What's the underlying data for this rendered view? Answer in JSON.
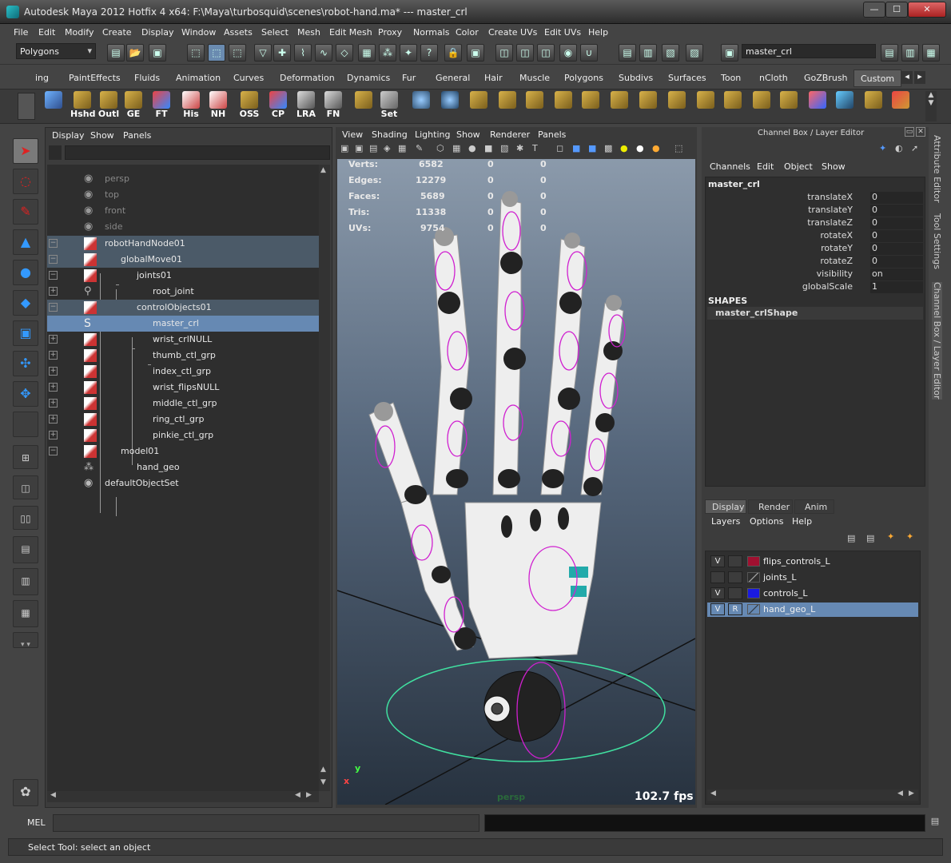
{
  "title": {
    "text": "Autodesk Maya 2012 Hotfix 4 x64: F:\\Maya\\turbosquid\\scenes\\robot-hand.ma*   ---   master_crl"
  },
  "menubar": [
    "File",
    "Edit",
    "Modify",
    "Create",
    "Display",
    "Window",
    "Assets",
    "Select",
    "Mesh",
    "Edit Mesh",
    "Proxy",
    "Normals",
    "Color",
    "Create UVs",
    "Edit UVs",
    "Help"
  ],
  "statusline": {
    "mode": "Polygons",
    "field_value": "master_crl"
  },
  "shelf_tabs": [
    "ing",
    "PaintEffects",
    "Fluids",
    "Animation",
    "Curves",
    "Deformation",
    "Dynamics",
    "Fur",
    "General",
    "Hair",
    "Muscle",
    "Polygons",
    "Subdivs",
    "Surfaces",
    "Toon",
    "nCloth",
    "GoZBrush",
    "Custom"
  ],
  "shelf_buttons": [
    "Hshd",
    "Outl",
    "GE",
    "FT",
    "His",
    "NH",
    "OSS",
    "CP",
    "LRA",
    "FN",
    "Set"
  ],
  "outliner": {
    "menu": [
      "Display",
      "Show",
      "Panels"
    ],
    "items": [
      {
        "label": "persp"
      },
      {
        "label": "top"
      },
      {
        "label": "front"
      },
      {
        "label": "side"
      },
      {
        "label": "robotHandNode01"
      },
      {
        "label": "globalMove01"
      },
      {
        "label": "joints01"
      },
      {
        "label": "root_joint"
      },
      {
        "label": "controlObjects01"
      },
      {
        "label": "master_crl"
      },
      {
        "label": "wrist_crlNULL"
      },
      {
        "label": "thumb_ctl_grp"
      },
      {
        "label": "index_ctl_grp"
      },
      {
        "label": "wrist_flipsNULL"
      },
      {
        "label": "middle_ctl_grp"
      },
      {
        "label": "ring_ctl_grp"
      },
      {
        "label": "pinkie_ctl_grp"
      },
      {
        "label": "model01"
      },
      {
        "label": "hand_geo"
      },
      {
        "label": "defaultObjectSet"
      }
    ]
  },
  "viewport": {
    "menu": [
      "View",
      "Shading",
      "Lighting",
      "Show",
      "Renderer",
      "Panels"
    ],
    "hud": [
      {
        "label": "Verts:",
        "v": "6582",
        "a": "0",
        "b": "0"
      },
      {
        "label": "Edges:",
        "v": "12279",
        "a": "0",
        "b": "0"
      },
      {
        "label": "Faces:",
        "v": "5689",
        "a": "0",
        "b": "0"
      },
      {
        "label": "Tris:",
        "v": "11338",
        "a": "0",
        "b": "0"
      },
      {
        "label": "UVs:",
        "v": "9754",
        "a": "0",
        "b": "0"
      }
    ],
    "fps": "102.7 fps",
    "camera": "persp",
    "axis_y": "y",
    "axis_x": "x"
  },
  "channel_box": {
    "header": "Channel Box / Layer Editor",
    "menu": [
      "Channels",
      "Edit",
      "Object",
      "Show"
    ],
    "object": "master_crl",
    "attrs": [
      {
        "name": "translateX",
        "value": "0"
      },
      {
        "name": "translateY",
        "value": "0"
      },
      {
        "name": "translateZ",
        "value": "0"
      },
      {
        "name": "rotateX",
        "value": "0"
      },
      {
        "name": "rotateY",
        "value": "0"
      },
      {
        "name": "rotateZ",
        "value": "0"
      },
      {
        "name": "visibility",
        "value": "on"
      },
      {
        "name": "globalScale",
        "value": "1"
      }
    ],
    "shapes_header": "SHAPES",
    "shape": "master_crlShape"
  },
  "layer_editor": {
    "tabs": [
      "Display",
      "Render",
      "Anim"
    ],
    "menu": [
      "Layers",
      "Options",
      "Help"
    ],
    "layers": [
      {
        "v": "V",
        "r": "",
        "name": "flips_controls_L",
        "color": "#a01030"
      },
      {
        "v": "",
        "r": "",
        "name": "joints_L",
        "color": ""
      },
      {
        "v": "V",
        "r": "",
        "name": "controls_L",
        "color": "#1a1ae0"
      },
      {
        "v": "V",
        "r": "R",
        "name": "hand_geo_L",
        "color": ""
      }
    ]
  },
  "side_tabs": [
    "Attribute Editor",
    "Tool Settings",
    "Channel Box / Layer Editor"
  ],
  "cmdline": {
    "label": "MEL"
  },
  "helpline": {
    "text": "Select Tool: select an object"
  }
}
